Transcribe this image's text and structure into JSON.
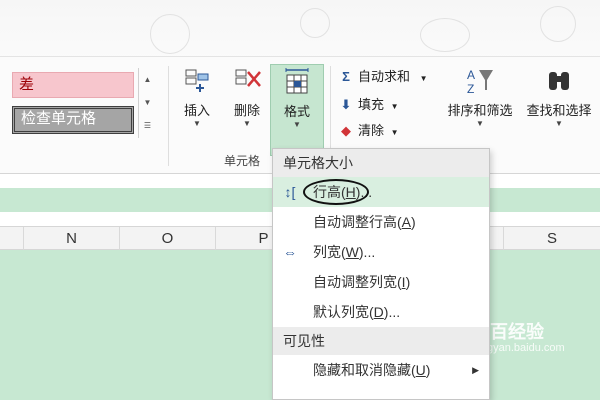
{
  "styles_gallery": {
    "bad_label": "差",
    "check_cell_label": "检查单元格"
  },
  "cells_group": {
    "insert_label": "插入",
    "delete_label": "删除",
    "format_label": "格式",
    "group_label": "单元格"
  },
  "editing_group": {
    "autosum_label": "自动求和",
    "fill_label": "填充",
    "clear_label": "清除",
    "sort_filter_label": "排序和筛选",
    "find_select_label": "查找和选择"
  },
  "column_headers": [
    "N",
    "O",
    "P",
    "S"
  ],
  "format_menu": {
    "section_cell_size": "单元格大小",
    "row_height": {
      "text": "行高(",
      "key": "H",
      "suffix": ")..."
    },
    "autofit_row_height": {
      "text": "自动调整行高(",
      "key": "A",
      "suffix": ")"
    },
    "column_width": {
      "text": "列宽(",
      "key": "W",
      "suffix": ")..."
    },
    "autofit_column_width": {
      "text": "自动调整列宽(",
      "key": "I",
      "suffix": ")"
    },
    "default_width": {
      "text": "默认列宽(",
      "key": "D",
      "suffix": ")..."
    },
    "section_visibility": "可见性",
    "hide_unhide": {
      "text": "隐藏和取消隐藏(",
      "key": "U",
      "suffix": ")"
    }
  },
  "watermark": {
    "brand": "Bai百经验",
    "url": "jingyan.baidu.com"
  },
  "colors": {
    "accent_green": "#c7e8d2",
    "bad_fill": "#f7c6cd",
    "check_fill": "#a5a5a5"
  }
}
